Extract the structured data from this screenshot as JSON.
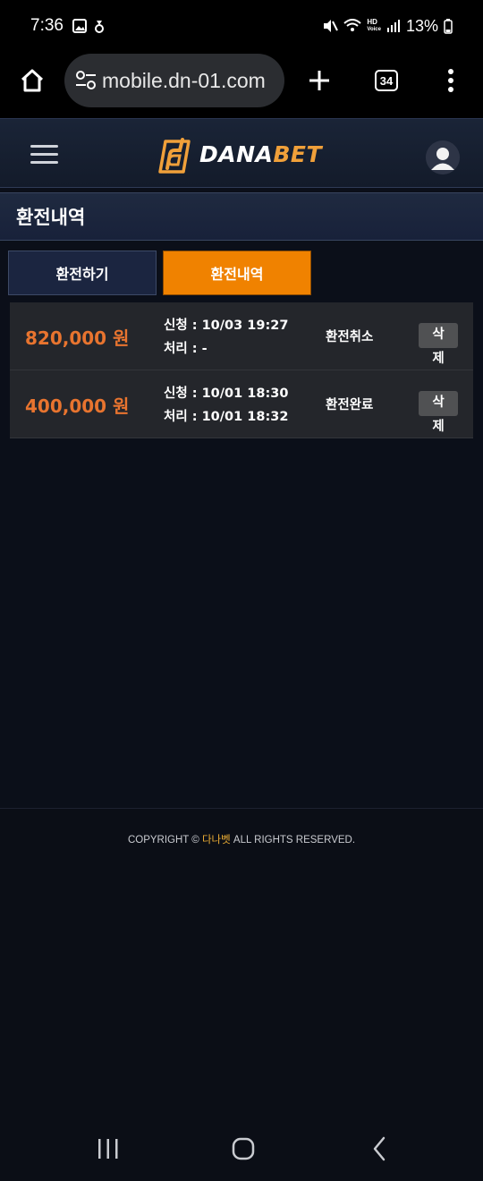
{
  "status_bar": {
    "time": "7:36",
    "battery": "13%",
    "hd_label": "HD",
    "voice_label": "Voice"
  },
  "browser": {
    "url": "mobile.dn-01.com",
    "tab_count": "34"
  },
  "site": {
    "logo_word_1": "DANA",
    "logo_word_2": "BET"
  },
  "page": {
    "title": "환전내역"
  },
  "tabs": [
    {
      "label": "환전하기",
      "active": false
    },
    {
      "label": "환전내역",
      "active": true
    }
  ],
  "history": [
    {
      "amount": "820,000 원",
      "request": "신청 : 10/03 19:27",
      "processed": "처리 : -",
      "status": "환전취소",
      "delete_label": "삭제"
    },
    {
      "amount": "400,000 원",
      "request": "신청 : 10/01 18:30",
      "processed": "처리 : 10/01 18:32",
      "status": "환전완료",
      "delete_label": "삭제"
    }
  ],
  "footer": {
    "copyright_prefix": "COPYRIGHT © ",
    "copyright_brand": "다나벳",
    "copyright_suffix": " ALL RIGHTS RESERVED."
  },
  "colors": {
    "accent": "#f08200",
    "amount": "#e8742f",
    "brand": "#f2b135",
    "background": "#0b0f19"
  }
}
